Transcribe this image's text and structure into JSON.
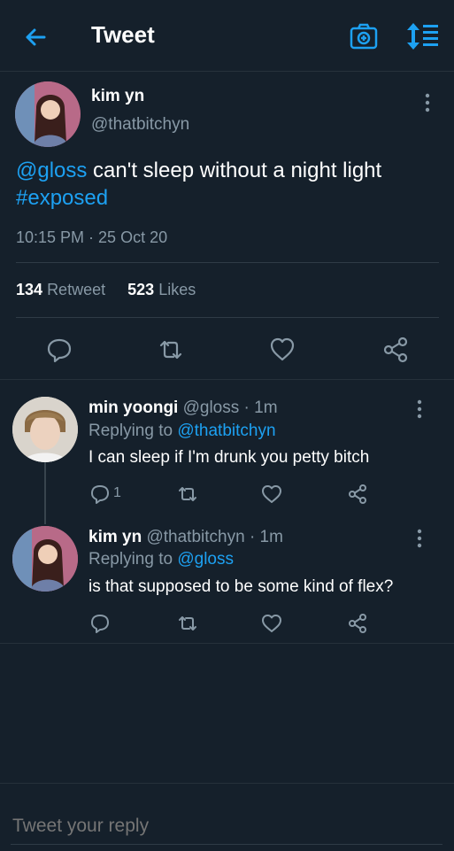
{
  "header": {
    "title": "Tweet"
  },
  "tweet": {
    "author_name": "kim yn",
    "author_handle": "@thatbitchyn",
    "text_mention": "@gloss",
    "text_body": " can't sleep without a night light",
    "text_hashtag": "#exposed",
    "timestamp": "10:15 PM · 25 Oct 20",
    "retweets_count": "134",
    "retweets_label": "Retweet",
    "likes_count": "523",
    "likes_label": "Likes"
  },
  "replies": [
    {
      "name": "min yoongi",
      "handle_time": "@gloss · 1m",
      "replying_prefix": "Replying to ",
      "replying_to": "@thatbitchyn",
      "text": "I can sleep if I'm drunk you petty bitch",
      "reply_count": "1"
    },
    {
      "name": "kim yn",
      "handle_time": "@thatbitchyn · 1m",
      "replying_prefix": "Replying to ",
      "replying_to": "@gloss",
      "text": "is that supposed to be some kind of flex?"
    }
  ],
  "compose": {
    "placeholder": "Tweet your reply"
  },
  "colors": {
    "background": "#15202b",
    "accent": "#1da1f2",
    "muted": "#8899a6"
  }
}
